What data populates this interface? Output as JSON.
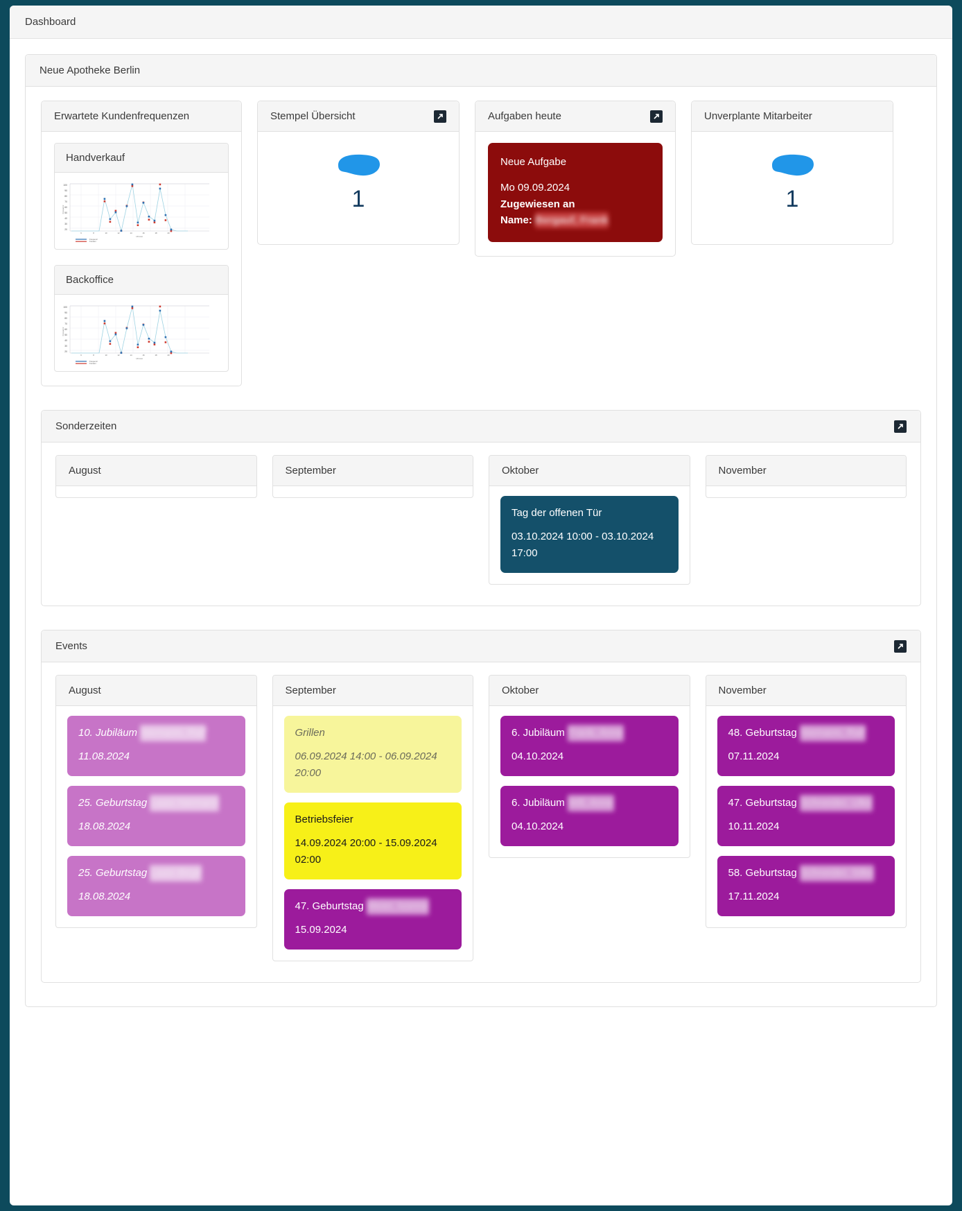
{
  "colors": {
    "page_background": "#0d4a5c",
    "panel_header": "#f5f5f5",
    "task_red": "#8c0c0c",
    "special_time_teal": "#14506a",
    "event_purple": "#9c1b9c",
    "event_purple_past": "#c774c7",
    "event_yellow": "#f7f018",
    "event_yellow_past": "#f7f59b",
    "big_number": "#123a5e",
    "blob_blue": "#2196e8"
  },
  "topbar": {
    "title": "Dashboard"
  },
  "store": {
    "title": "Neue Apotheke Berlin"
  },
  "widgets": {
    "frequencies": {
      "title": "Erwartete Kundenfrequenzen",
      "cards": [
        {
          "title": "Handverkauf"
        },
        {
          "title": "Backoffice"
        }
      ]
    },
    "stamps": {
      "title": "Stempel Übersicht",
      "expand_icon": "expand-icon",
      "count": "1"
    },
    "tasks": {
      "title": "Aufgaben heute",
      "expand_icon": "expand-icon",
      "card": {
        "title": "Neue Aufgabe",
        "date": "Mo 09.09.2024",
        "assigned_label": "Zugewiesen an",
        "name_label": "Name:",
        "name_value": "Bergauf, Frank"
      }
    },
    "unplanned_staff": {
      "title": "Unverplante Mitarbeiter",
      "count": "1"
    }
  },
  "special_times": {
    "title": "Sonderzeiten",
    "expand_icon": "expand-icon",
    "months": [
      {
        "name": "August",
        "events": []
      },
      {
        "name": "September",
        "events": []
      },
      {
        "name": "Oktober",
        "events": [
          {
            "title": "Tag der offenen Tür",
            "range": "03.10.2024 10:00 - 03.10.2024 17:00",
            "style": "teal"
          }
        ]
      },
      {
        "name": "November",
        "events": []
      }
    ]
  },
  "events": {
    "title": "Events",
    "expand_icon": "expand-icon",
    "months": [
      {
        "name": "August",
        "events": [
          {
            "title": "10. Jubiläum",
            "name": "Niemann, Ralf",
            "date": "11.08.2024",
            "style": "purple-past",
            "redacted": true
          },
          {
            "title": "25. Geburtstag",
            "name": "Laasi Niemann",
            "date": "18.08.2024",
            "style": "purple-past",
            "redacted": true
          },
          {
            "title": "25. Geburtstag",
            "name": "Laasi Birgit",
            "date": "18.08.2024",
            "style": "purple-past",
            "redacted": true
          }
        ]
      },
      {
        "name": "September",
        "events": [
          {
            "title": "Grillen",
            "range": "06.09.2024 14:00 - 06.09.2024 20:00",
            "style": "yellow-past",
            "redacted": false
          },
          {
            "title": "Betriebsfeier",
            "range": "14.09.2024 20:00 - 15.09.2024 02:00",
            "style": "yellow",
            "redacted": false
          },
          {
            "title": "47. Geburtstag",
            "name": "Meier, Ivonne",
            "date": "15.09.2024",
            "style": "purple",
            "redacted": true
          }
        ]
      },
      {
        "name": "Oktober",
        "events": [
          {
            "title": "6. Jubiläum",
            "name": "Frank, Anne",
            "date": "04.10.2024",
            "style": "purple",
            "redacted": true
          },
          {
            "title": "6. Jubiläum",
            "name": "Will, Anne",
            "date": "04.10.2024",
            "style": "purple",
            "redacted": true
          }
        ]
      },
      {
        "name": "November",
        "events": [
          {
            "title": "48. Geburtstag",
            "name": "Niemann, Ralf",
            "date": "07.11.2024",
            "style": "purple",
            "redacted": true
          },
          {
            "title": "47. Geburtstag",
            "name": "Schneider, Ulke",
            "date": "10.11.2024",
            "style": "purple",
            "redacted": true
          },
          {
            "title": "58. Geburtstag",
            "name": "Schneider, Silke",
            "date": "17.11.2024",
            "style": "purple",
            "redacted": true
          }
        ]
      }
    ]
  },
  "chart_data": [
    {
      "type": "line",
      "title": "Handverkauf",
      "xlabel": "Uhrzeit",
      "ylabel": "Frequenz",
      "ylim": [
        20,
        100
      ],
      "yticks": [
        20,
        30,
        40,
        50,
        60,
        70,
        80,
        90,
        100
      ],
      "x": [
        1,
        2,
        3,
        4,
        5,
        6,
        7,
        8,
        9,
        10,
        11,
        12,
        13,
        14,
        15,
        16,
        17,
        18,
        19,
        20,
        21,
        22
      ],
      "legend": [
        "Frequenz",
        "Kunden"
      ],
      "legend_position": "bottom",
      "grid": true,
      "series": [
        {
          "name": "Frequenz",
          "color": "#2f6fb0",
          "values": [
            20,
            20,
            20,
            20,
            20,
            20,
            76,
            41,
            54,
            20,
            60,
            98,
            33,
            66,
            42,
            34,
            91,
            46,
            22,
            20,
            20,
            20
          ]
        },
        {
          "name": "Kunden",
          "color": "#cf3b30",
          "values": [
            20,
            20,
            20,
            20,
            20,
            20,
            72,
            37,
            57,
            22,
            62,
            97,
            30,
            68,
            36,
            33,
            99,
            37,
            21,
            20,
            20,
            20
          ]
        }
      ]
    },
    {
      "type": "line",
      "title": "Backoffice",
      "xlabel": "Uhrzeit",
      "ylabel": "Frequenz",
      "ylim": [
        20,
        100
      ],
      "yticks": [
        20,
        30,
        40,
        50,
        60,
        70,
        80,
        90,
        100
      ],
      "x": [
        1,
        2,
        3,
        4,
        5,
        6,
        7,
        8,
        9,
        10,
        11,
        12,
        13,
        14,
        15,
        16,
        17,
        18,
        19,
        20,
        21,
        22
      ],
      "legend": [
        "Frequenz",
        "Kunden"
      ],
      "legend_position": "bottom",
      "grid": true,
      "series": [
        {
          "name": "Frequenz",
          "color": "#2f6fb0",
          "values": [
            20,
            20,
            20,
            20,
            20,
            20,
            76,
            41,
            54,
            20,
            60,
            98,
            33,
            66,
            42,
            34,
            91,
            46,
            22,
            20,
            20,
            20
          ]
        },
        {
          "name": "Kunden",
          "color": "#cf3b30",
          "values": [
            20,
            20,
            20,
            20,
            20,
            20,
            72,
            37,
            57,
            22,
            62,
            97,
            30,
            68,
            36,
            33,
            99,
            37,
            21,
            20,
            20,
            20
          ]
        }
      ]
    }
  ]
}
